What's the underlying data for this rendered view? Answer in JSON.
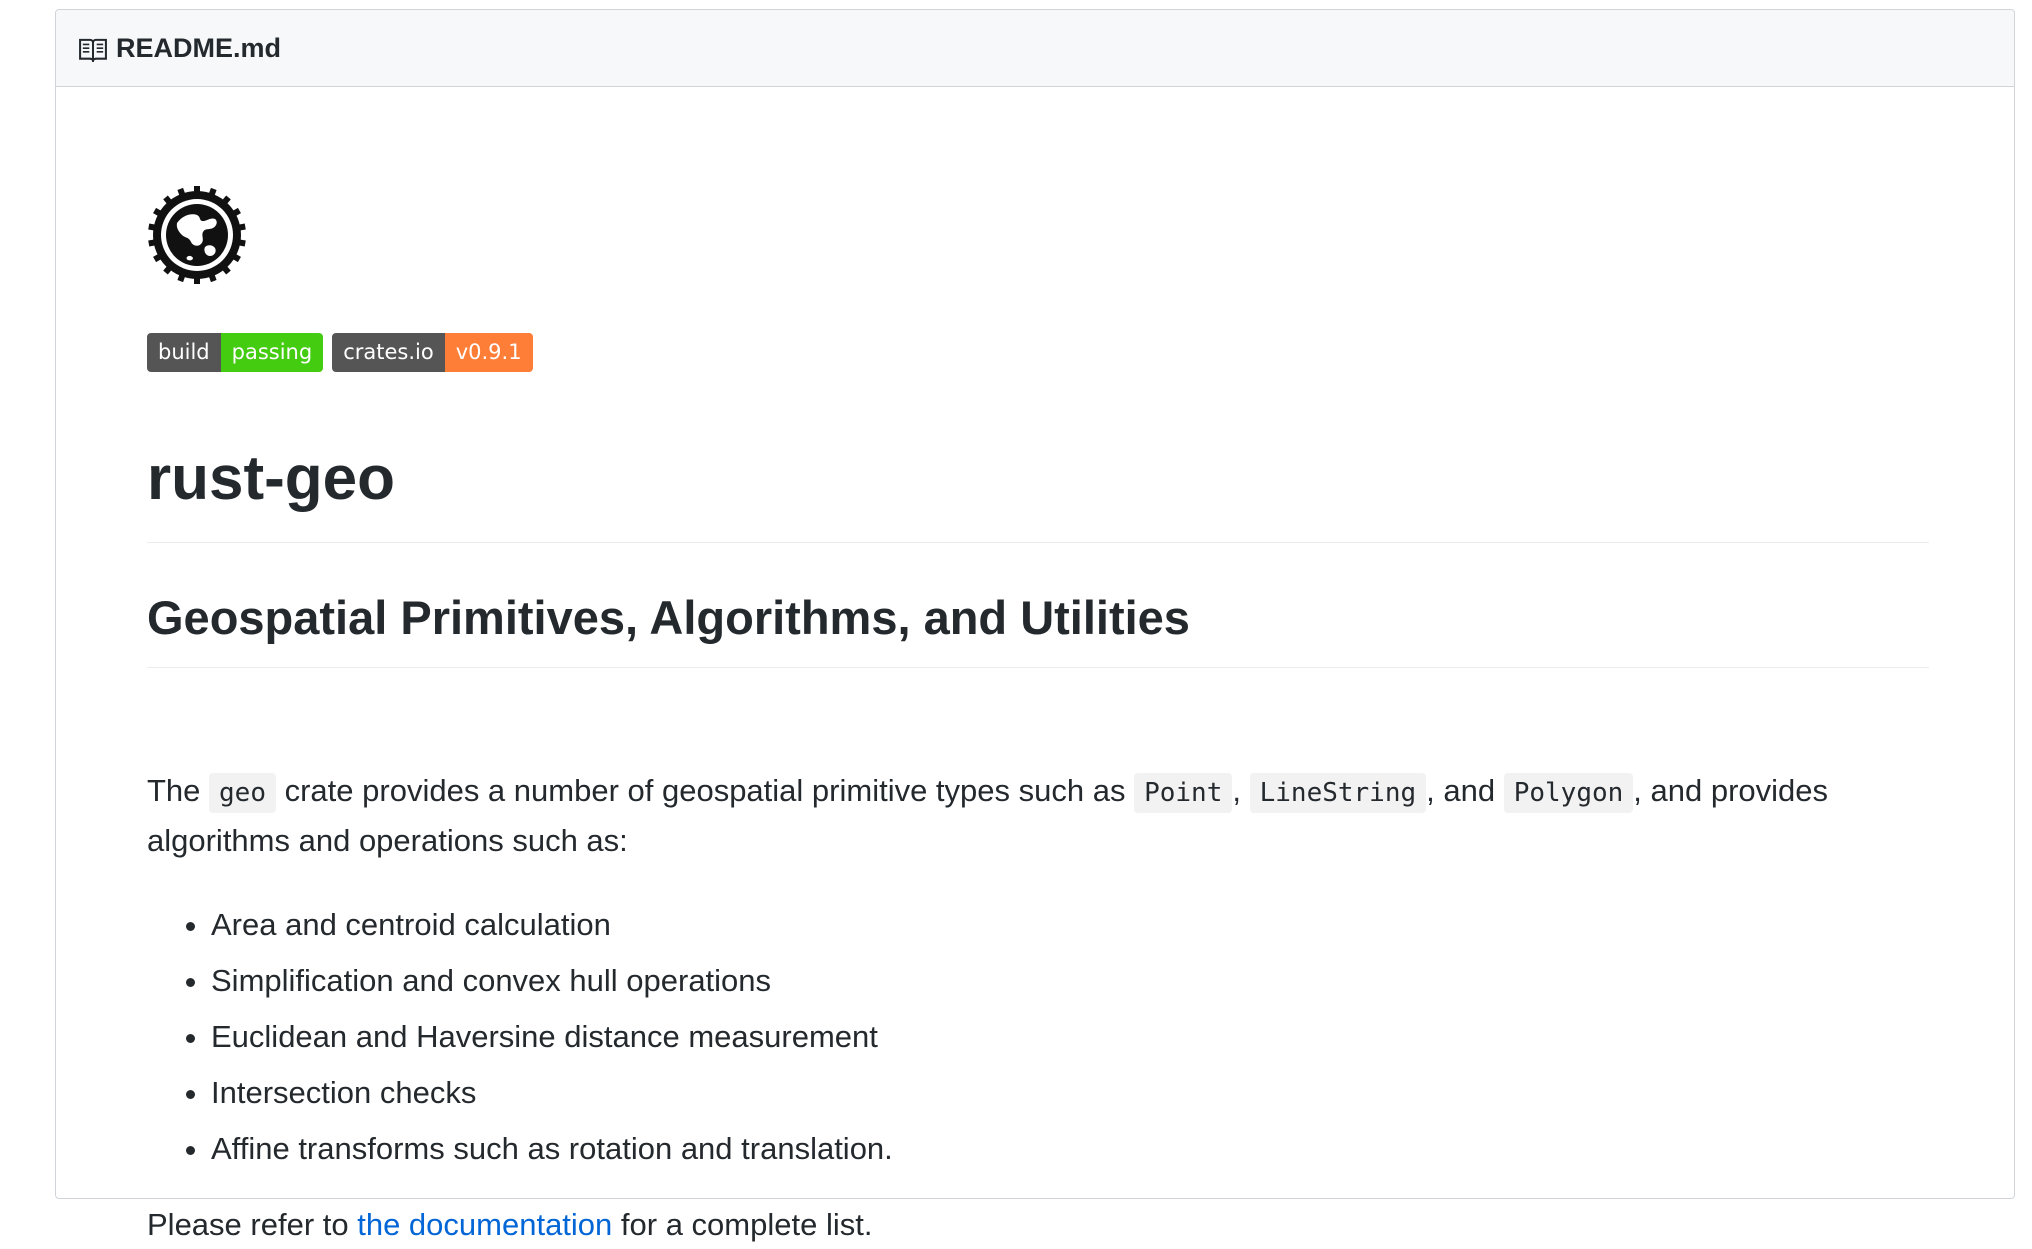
{
  "header": {
    "icon": "book-icon",
    "filename": "README.md"
  },
  "logo": {
    "icon": "geo-logo-icon"
  },
  "badges": [
    {
      "left": "build",
      "right": "passing",
      "right_color": "#44cc11"
    },
    {
      "left": "crates.io",
      "right": "v0.9.1",
      "right_color": "#fe7d37"
    }
  ],
  "title": "rust-geo",
  "subtitle": "Geospatial Primitives, Algorithms, and Utilities",
  "intro": {
    "t1": "The ",
    "c1": "geo",
    "t2": " crate provides a number of geospatial primitive types such as ",
    "c2": "Point",
    "t3": ", ",
    "c3": "LineString",
    "t4": ", and ",
    "c4": "Polygon",
    "t5": ", and provides algorithms and operations such as:"
  },
  "features": [
    "Area and centroid calculation",
    "Simplification and convex hull operations",
    "Euclidean and Haversine distance measurement",
    "Intersection checks",
    "Affine transforms such as rotation and translation."
  ],
  "footer_para": {
    "before": "Please refer to ",
    "link": "the documentation",
    "after": " for a complete list."
  },
  "colors": {
    "link": "#0366d6",
    "badge_left": "#555555"
  }
}
